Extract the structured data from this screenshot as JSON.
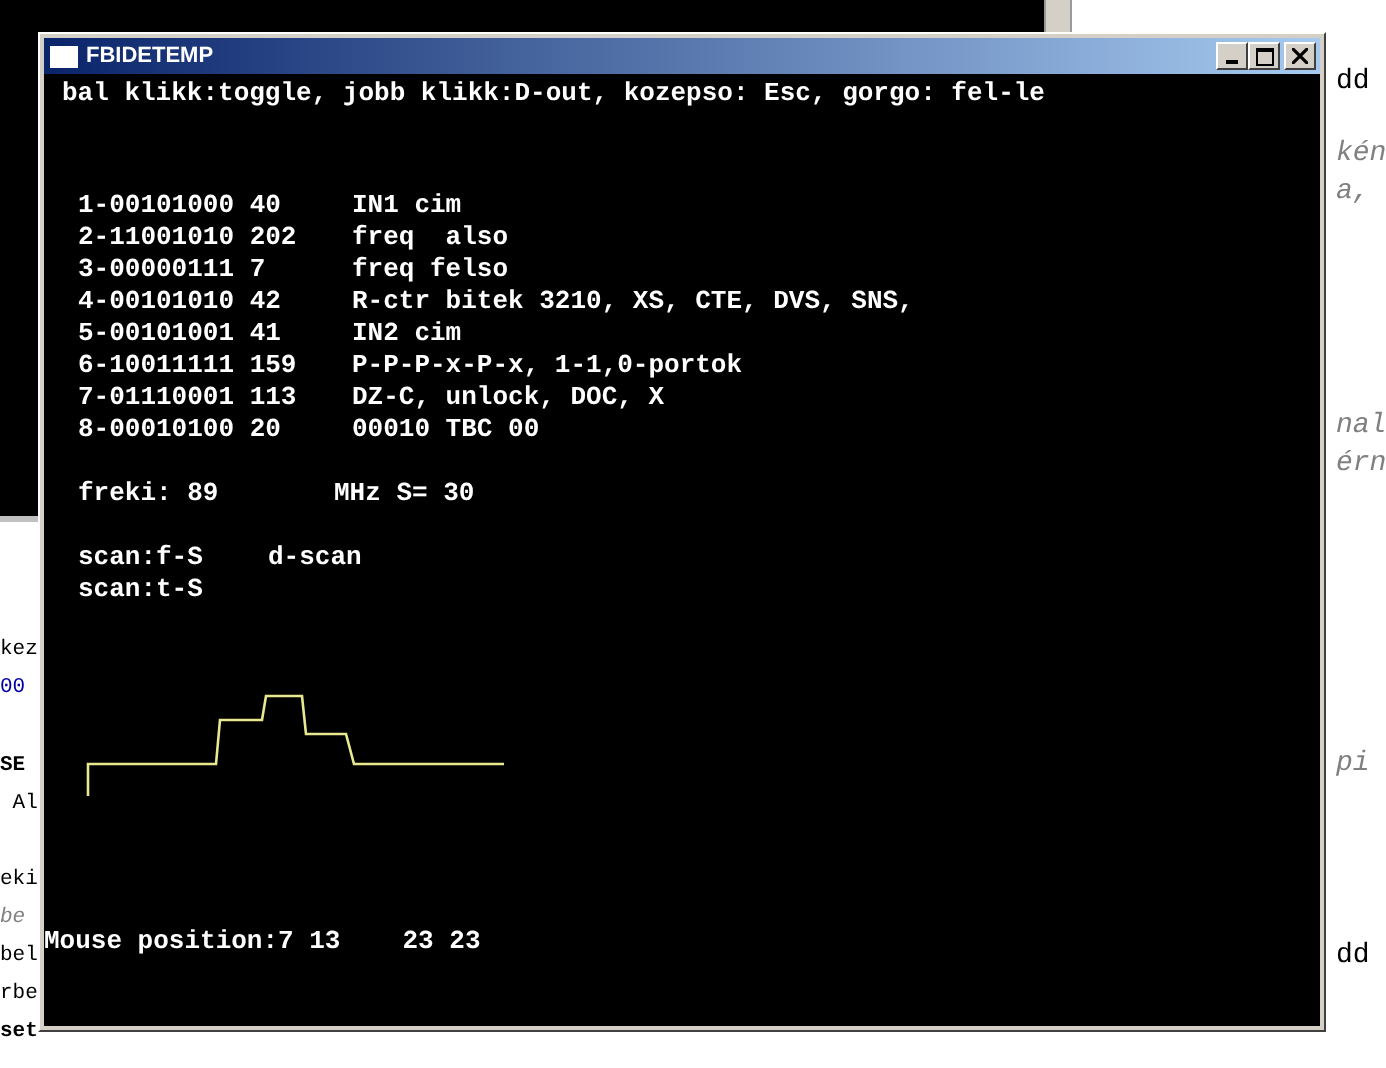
{
  "window": {
    "title": "FBIDETEMP"
  },
  "help_line": "bal klikk:toggle, jobb klikk:D-out, kozepso: Esc, gorgo: fel-le",
  "registers": [
    {
      "code": "1-00101000 40",
      "description": "IN1 cim"
    },
    {
      "code": "2-11001010 202",
      "description": "freq  also"
    },
    {
      "code": "3-00000111 7",
      "description": "freq felso"
    },
    {
      "code": "4-00101010 42",
      "description": "R-ctr bitek 3210, XS, CTE, DVS, SNS,"
    },
    {
      "code": "5-00101001 41",
      "description": "IN2 cim"
    },
    {
      "code": "6-10011111 159",
      "description": "P-P-P-x-P-x, 1-1,0-portok"
    },
    {
      "code": "7-01110001 113",
      "description": "DZ-C, unlock, DOC, X"
    },
    {
      "code": "8-00010100 20",
      "description": "00010 TBC 00"
    }
  ],
  "frequency": {
    "label": "freki: 89",
    "unit": "MHz S= 30"
  },
  "scan": [
    {
      "label": "scan:f-S",
      "mode": "d-scan"
    },
    {
      "label": "scan:t-S"
    }
  ],
  "mouse_position": {
    "label": "Mouse position:7 13",
    "value": "23 23"
  },
  "background_editor": {
    "left_groups": [
      [
        {
          "text": "kez",
          "kind": "code"
        },
        {
          "text": "00",
          "kind": "number"
        }
      ],
      [
        {
          "text": "SE",
          "kind": "keyword"
        },
        {
          "text": " Al",
          "kind": "code"
        }
      ],
      [
        {
          "text": "eki",
          "kind": "code"
        },
        {
          "text": "be",
          "kind": "comment"
        },
        {
          "text": "bel",
          "kind": "code"
        },
        {
          "text": "rbe",
          "kind": "code"
        },
        {
          "text": "set",
          "kind": "keyword"
        }
      ]
    ],
    "right_groups": [
      [
        {
          "text": "dd",
          "kind": "code"
        },
        {
          "text": "kén",
          "kind": "comment"
        },
        {
          "text": "a,",
          "kind": "comment"
        }
      ],
      [
        {
          "text": "nal",
          "kind": "comment"
        },
        {
          "text": "érn",
          "kind": "comment"
        }
      ],
      [
        {
          "text": "pi",
          "kind": "comment"
        }
      ],
      [
        {
          "text": "dd",
          "kind": "code"
        }
      ]
    ]
  }
}
